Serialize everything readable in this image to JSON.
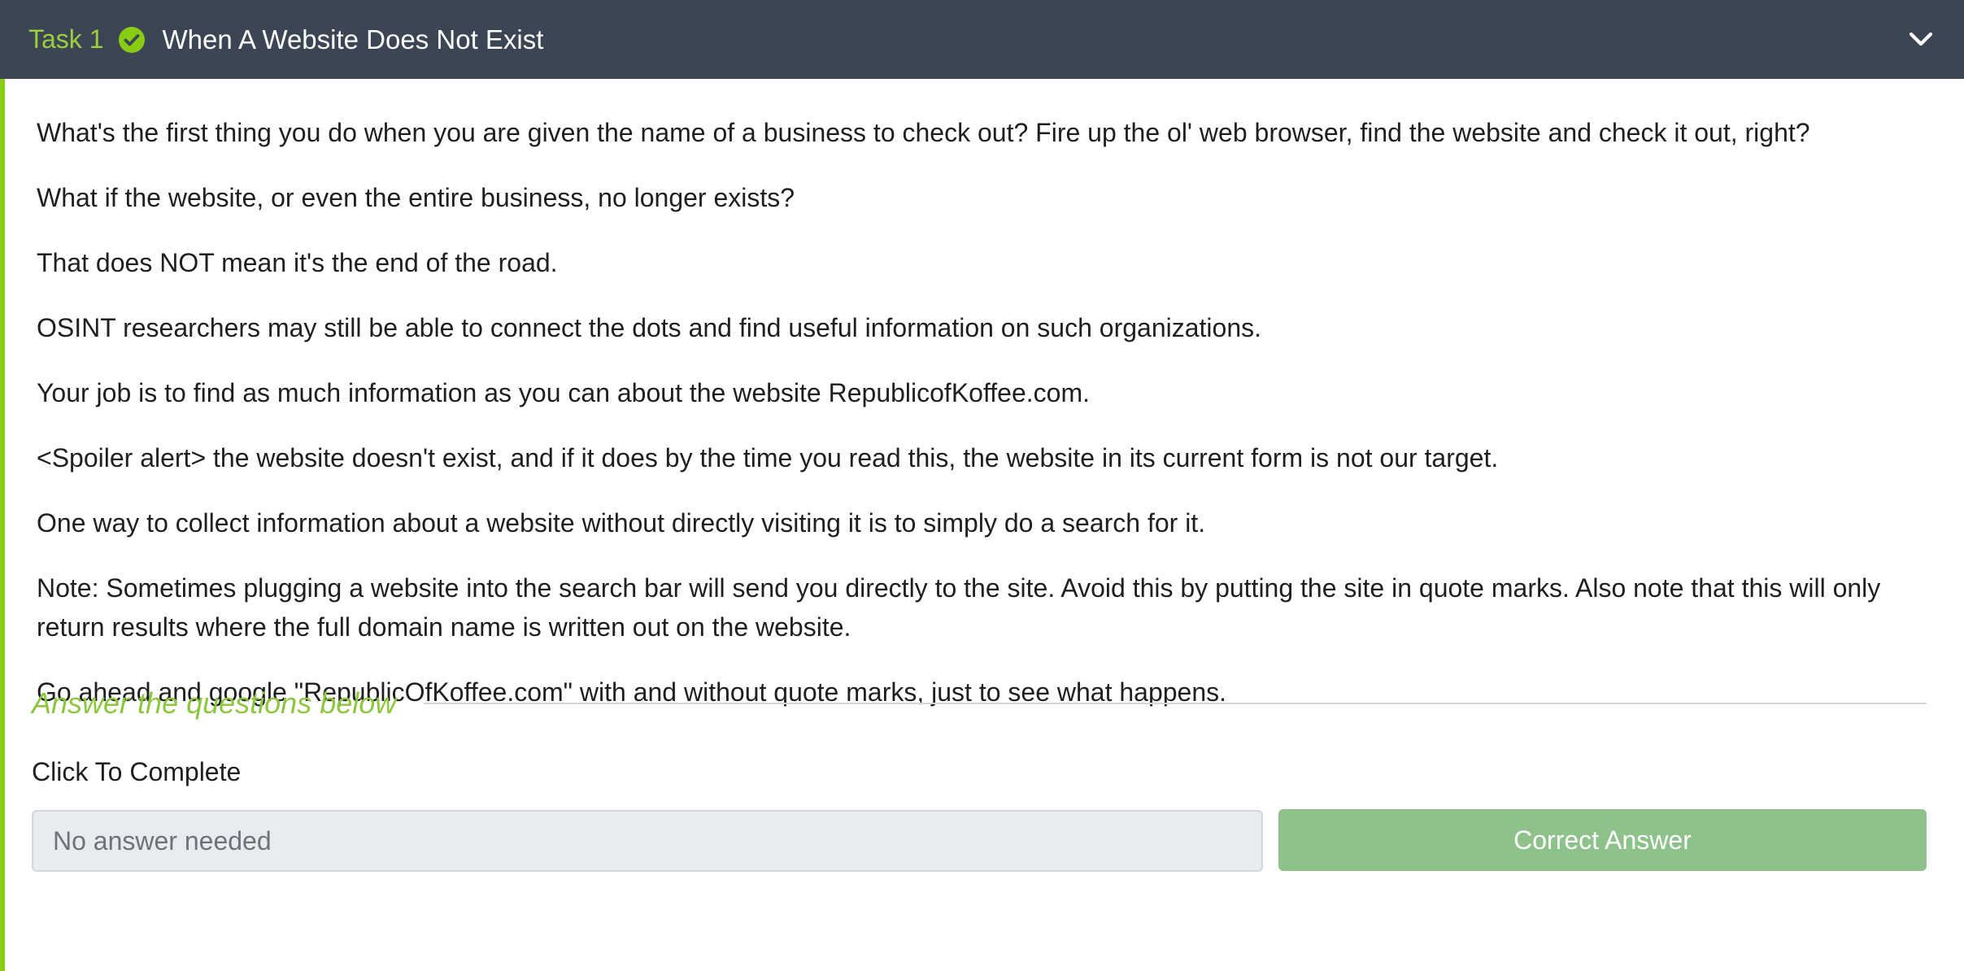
{
  "header": {
    "task_number": "Task 1",
    "title": "When A Website Does Not Exist",
    "icons": {
      "status": "check-circle-icon",
      "toggle": "chevron-down-icon"
    }
  },
  "content": {
    "paragraphs": [
      "What's the first thing you do when you are given the name of a business to check out? Fire up the ol' web browser, find the website and check it out, right?",
      "What if the website, or even the entire business, no longer exists?",
      "That does NOT mean it's the end of the road.",
      "OSINT researchers may still be able to connect the dots and find useful information on such organizations.",
      "Your job is to find as much information as you can about the website RepublicofKoffee.com.",
      "<Spoiler alert> the website doesn't exist, and if it does by the time you read this, the website in its current form is not our target.",
      "One way to collect information about a website without directly visiting it is to simply do a search for it.",
      "Note: Sometimes plugging a website into the search bar will send you directly to the site. Avoid this by putting the site in quote marks. Also note that this will only return results where the full domain name is written out on the website.",
      "Go ahead and google \"RepublicOfKoffee.com\" with and without quote marks, just to see what happens."
    ]
  },
  "answers": {
    "heading": "Answer the questions below",
    "questions": [
      {
        "label": "Click To Complete",
        "input_placeholder": "No answer needed",
        "input_value": "",
        "button_label": "Correct Answer"
      }
    ]
  },
  "colors": {
    "header_background": "#3b4553",
    "accent_green": "#88cc14",
    "correct_button": "#8dc38a",
    "input_background": "#e9ecef"
  }
}
